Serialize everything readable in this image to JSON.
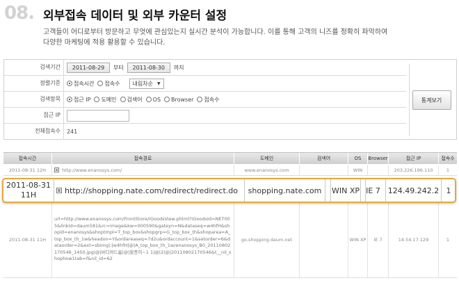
{
  "header": {
    "section_number": "08.",
    "title": "외부접속 데이터 및 외부 카운터 설정",
    "description_line1": "고객들이 어디로부터 방문하고 무엇에 관심있는지 실시간 분석이 가능합니다. 이를 통해 고객의 니즈를 정확히 파악하여",
    "description_line2": "다양한 마케팅에 적용 활용할 수 있습니다."
  },
  "form": {
    "period": {
      "label": "검색기간",
      "start": "2011-08-29",
      "between": "부터",
      "end": "2011-08-30",
      "until": "까지"
    },
    "sort": {
      "label": "정렬기준",
      "options": [
        "접속시간",
        "접속수"
      ],
      "selected_index": 0,
      "order": "내림차순"
    },
    "field": {
      "label": "검색항목",
      "options": [
        "접근 IP",
        "도메인",
        "검색어",
        "OS",
        "Browser",
        "접속수"
      ],
      "selected_index": 0
    },
    "ip": {
      "label": "접근 IP",
      "value": ""
    },
    "total": {
      "label": "전체접속수",
      "value": "241"
    },
    "stat_button": "통계보기"
  },
  "table": {
    "columns": [
      "접속시간",
      "접속경로",
      "도메인",
      "검색어",
      "OS",
      "Browser",
      "접근 IP",
      "접속수"
    ],
    "rows": [
      {
        "time": "2011-08-31 12H",
        "path": "http://www.enanosys.com/",
        "domain": "www.enanosys.com",
        "keyword": "",
        "os": "WIN",
        "browser": "",
        "ip": "203.226.196.110",
        "count": "1"
      },
      {
        "time": "2011-08-31 11H",
        "path": "http://shopping.nate.com/redirect/redirect.do",
        "domain": "shopping.nate.com",
        "keyword": "",
        "os": "WIN XP",
        "browser": "IE 7",
        "ip": "124.49.242.2",
        "count": "1"
      },
      {
        "time": "2011-08-31 11H",
        "path": "url=http://www.enanosys.com/FrontStore/iGoodsView.phtml?iGoodsId=NET005&linkId=daum581&rc=image&kw=000590&gateyn=N&dataseq=w4hfH&shopid=enanosys&shoptmpl=T_top_box&shopgrp=G_top_box_th&shoparea=A_top_box_th_1w&headon=Y&ordareaseq=7d2u&ordaccount=1&setorder=6&dataorder=2&ext=sbimg|:|w4hfH|@|A_top_box_th_1w/enanosys_B0_20110802170546_1450.jpg|@|바디여드름|@|할증히~1 1|@|2|@|20110802170546&t__nil_shophow1tab=f&nil_id=62",
        "domain": "go.shopping.daum.net",
        "keyword": "",
        "os": "WIN XP",
        "browser": "IE 7",
        "ip": "14.54.17.129",
        "count": "1"
      }
    ]
  }
}
